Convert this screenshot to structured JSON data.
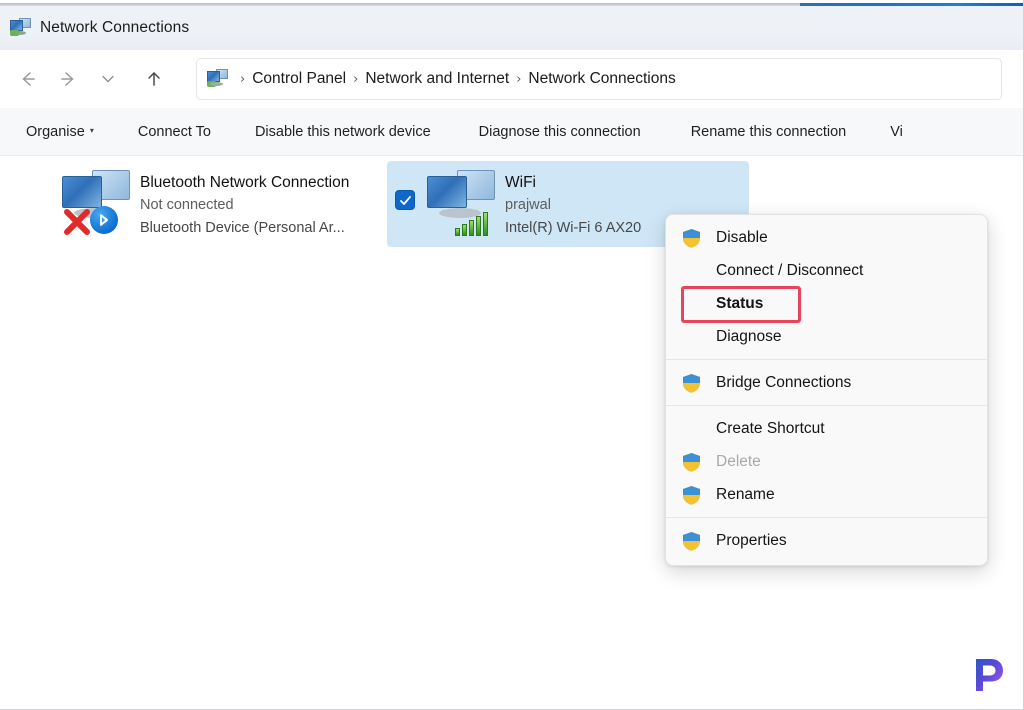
{
  "window": {
    "title": "Network Connections",
    "title_icon": "network-connections-icon"
  },
  "navbar": {
    "back_icon": "arrow-left-icon",
    "forward_icon": "arrow-right-icon",
    "recent_icon": "chevron-down-icon",
    "up_icon": "arrow-up-icon",
    "breadcrumb_icon": "control-panel-icon",
    "breadcrumb": [
      {
        "label": "Control Panel"
      },
      {
        "label": "Network and Internet"
      },
      {
        "label": "Network Connections"
      }
    ],
    "separator": "›"
  },
  "toolbar": {
    "items": [
      {
        "label": "Organise",
        "has_caret": true
      },
      {
        "label": "Connect To",
        "has_caret": false
      },
      {
        "label": "Disable this network device",
        "has_caret": false
      },
      {
        "label": "Diagnose this connection",
        "has_caret": false
      },
      {
        "label": "Rename this connection",
        "has_caret": false
      },
      {
        "label": "Vi",
        "has_caret": false
      }
    ]
  },
  "connections": [
    {
      "name": "Bluetooth Network Connection",
      "status": "Not connected",
      "device": "Bluetooth Device (Personal Ar...",
      "selected": false,
      "checked": false,
      "icon": "network-adapter-icon",
      "badge": "bluetooth-icon",
      "error_badge": "red-x-icon"
    },
    {
      "name": "WiFi",
      "status": "prajwal",
      "device": "Intel(R) Wi-Fi 6 AX20",
      "selected": true,
      "checked": true,
      "icon": "network-adapter-icon",
      "badge": "wifi-signal-icon",
      "error_badge": ""
    }
  ],
  "context_menu": {
    "groups": [
      {
        "items": [
          {
            "label": "Disable",
            "icon": "shield-icon",
            "bold": false,
            "disabled": false
          },
          {
            "label": "Connect / Disconnect",
            "icon": "",
            "bold": false,
            "disabled": false
          },
          {
            "label": "Status",
            "icon": "",
            "bold": true,
            "disabled": false
          },
          {
            "label": "Diagnose",
            "icon": "",
            "bold": false,
            "disabled": false
          }
        ]
      },
      {
        "items": [
          {
            "label": "Bridge Connections",
            "icon": "shield-icon",
            "bold": false,
            "disabled": false
          }
        ]
      },
      {
        "items": [
          {
            "label": "Create Shortcut",
            "icon": "",
            "bold": false,
            "disabled": false
          },
          {
            "label": "Delete",
            "icon": "shield-icon",
            "bold": false,
            "disabled": true
          },
          {
            "label": "Rename",
            "icon": "shield-icon",
            "bold": false,
            "disabled": false
          }
        ]
      },
      {
        "items": [
          {
            "label": "Properties",
            "icon": "shield-icon",
            "bold": false,
            "disabled": false
          }
        ]
      }
    ]
  },
  "annotation": {
    "target_label": "Status",
    "color": "#e8455c"
  },
  "watermark": {
    "letter": "P",
    "color_start": "#3f4fd8",
    "color_end": "#9b5cf0"
  },
  "colors": {
    "selection_blue": "#cfe6f7",
    "checkbox_blue": "#0d68c9",
    "toolbar_bg": "#f7f8fa",
    "titlebar_bg": "#eef1f6",
    "menu_bg": "#f9f9f9"
  }
}
